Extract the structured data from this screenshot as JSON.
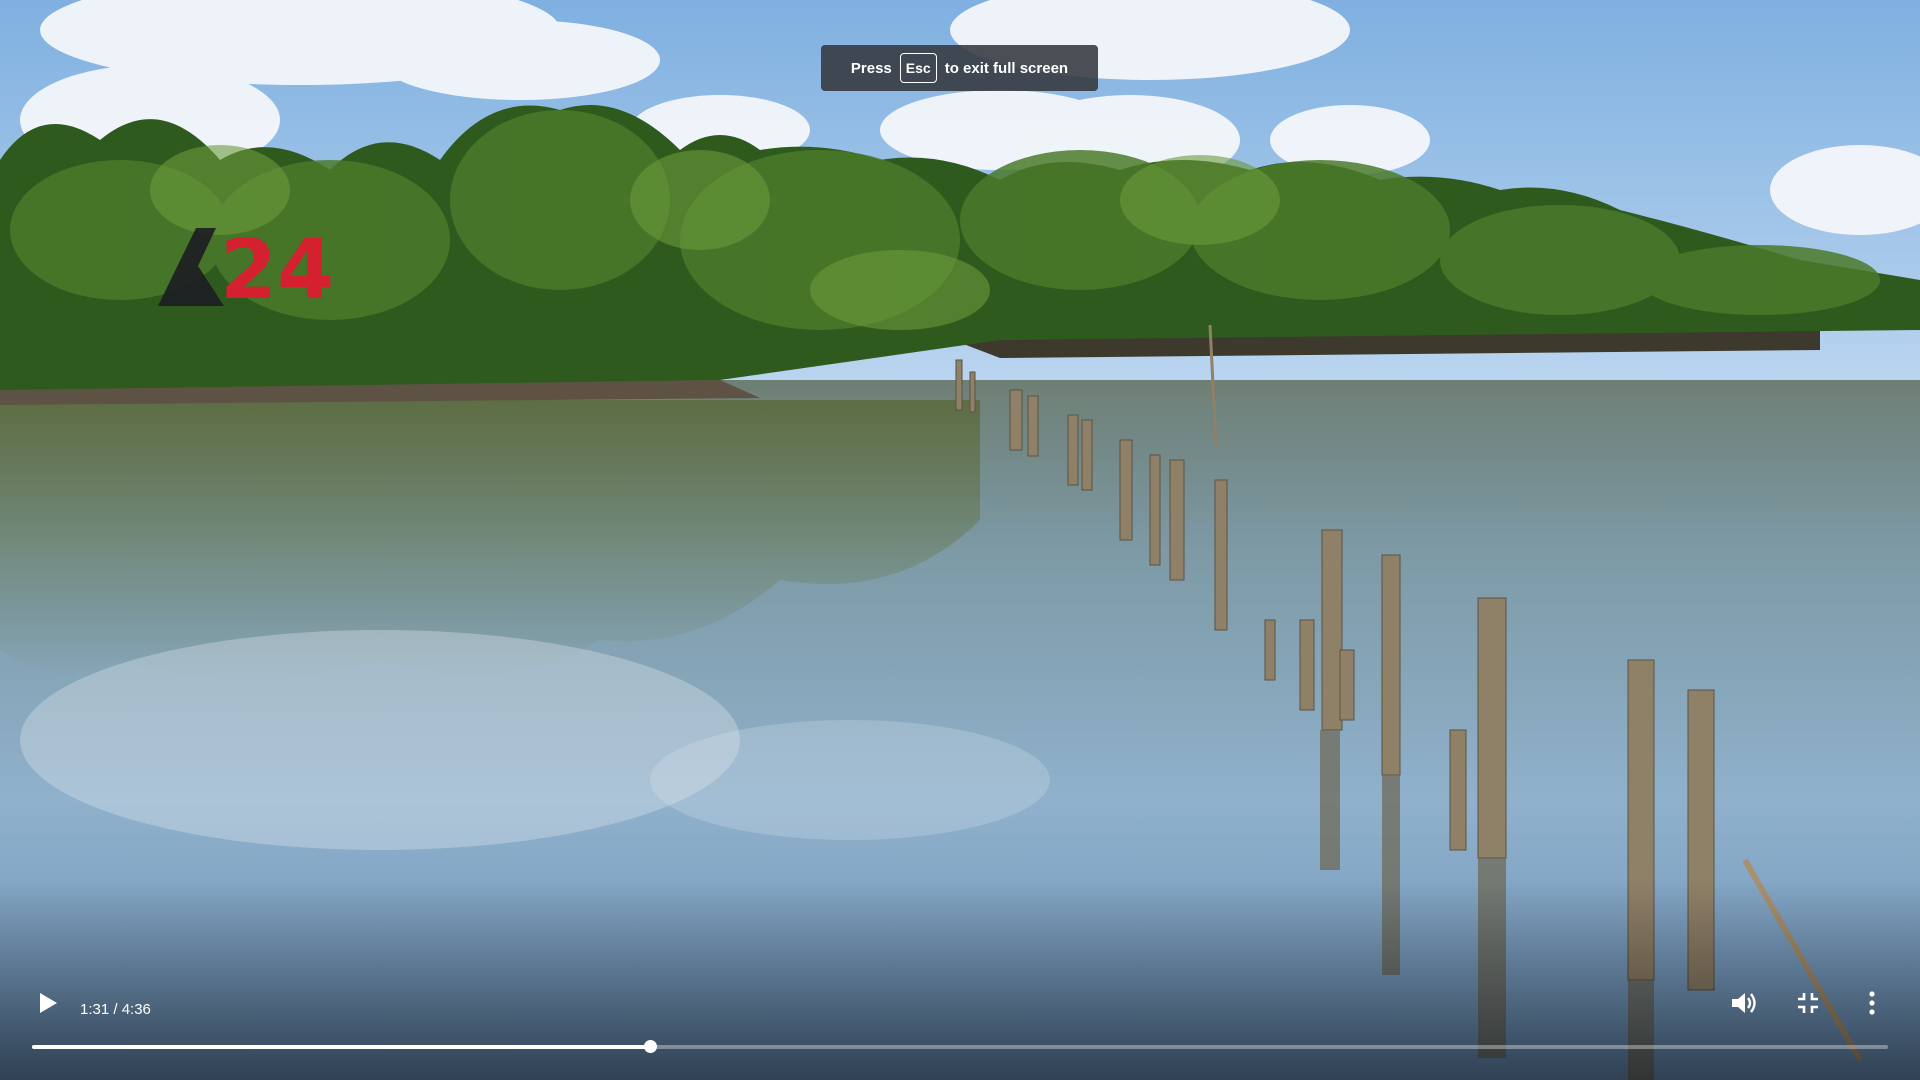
{
  "fullscreen_toast": {
    "press": "Press",
    "key": "Esc",
    "rest": "to exit full screen"
  },
  "video": {
    "description_icon": "channel-logo",
    "logo_text": "24"
  },
  "controls": {
    "time_display": "1:31 / 4:36",
    "progress_fraction": 0.333,
    "play_icon": "play-icon",
    "volume_icon": "volume-icon",
    "exit_fullscreen_icon": "exit-fullscreen-icon",
    "more_icon": "more-vertical-icon"
  },
  "colors": {
    "logo_red": "#d4202f",
    "logo_dark": "#1c1c22"
  }
}
